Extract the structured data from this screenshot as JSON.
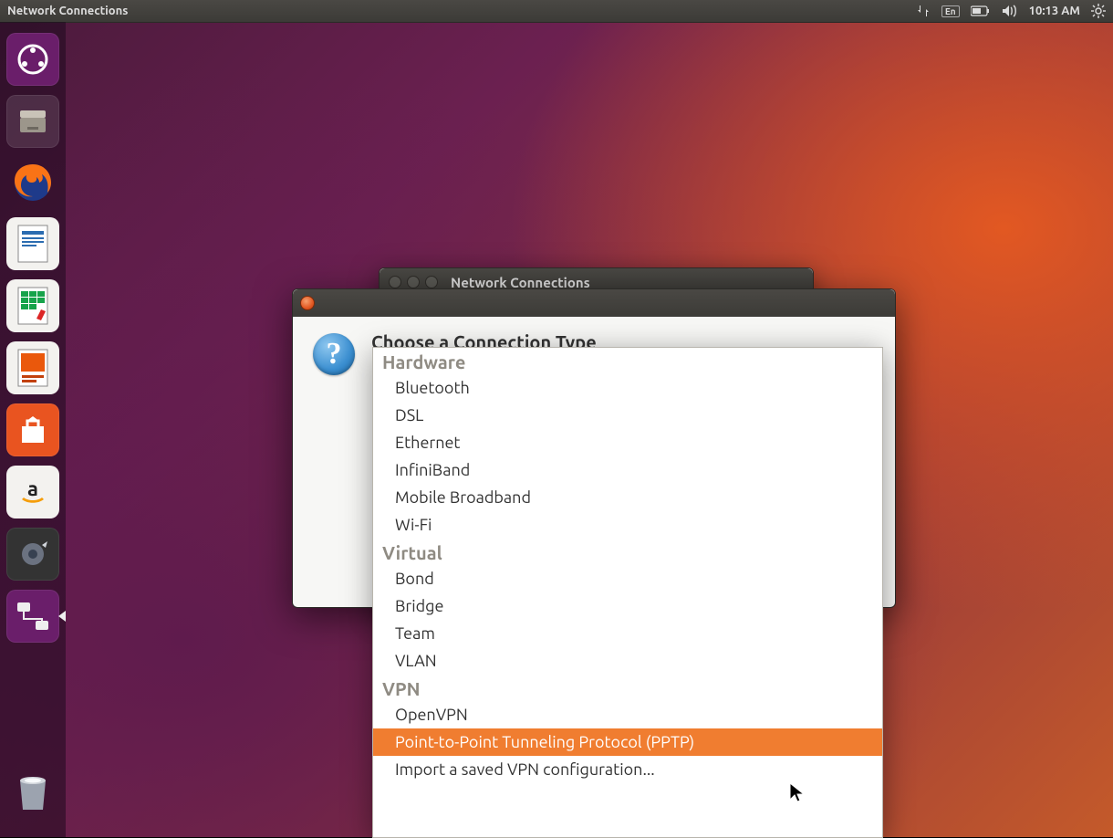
{
  "topbar": {
    "title": "Network Connections",
    "lang": "En",
    "time": "10:13 AM"
  },
  "launcher": {
    "items": [
      {
        "name": "dash",
        "label": "Ubuntu Dash"
      },
      {
        "name": "files",
        "label": "Files"
      },
      {
        "name": "firefox",
        "label": "Firefox"
      },
      {
        "name": "writer",
        "label": "LibreOffice Writer"
      },
      {
        "name": "calc",
        "label": "LibreOffice Calc"
      },
      {
        "name": "impress",
        "label": "LibreOffice Impress"
      },
      {
        "name": "software",
        "label": "Ubuntu Software"
      },
      {
        "name": "amazon",
        "label": "Amazon"
      },
      {
        "name": "settings",
        "label": "System Settings"
      },
      {
        "name": "network",
        "label": "Network Connections"
      }
    ],
    "trash": "Trash"
  },
  "bgWindow": {
    "title": "Network Connections"
  },
  "dialog": {
    "heading": "Choose a Connection Type",
    "groups": [
      {
        "label": "Hardware",
        "items": [
          "Bluetooth",
          "DSL",
          "Ethernet",
          "InfiniBand",
          "Mobile Broadband",
          "Wi-Fi"
        ]
      },
      {
        "label": "Virtual",
        "items": [
          "Bond",
          "Bridge",
          "Team",
          "VLAN"
        ]
      },
      {
        "label": "VPN",
        "items": [
          "OpenVPN",
          "Point-to-Point Tunneling Protocol (PPTP)",
          "Import a saved VPN configuration..."
        ]
      }
    ],
    "selected": "Point-to-Point Tunneling Protocol (PPTP)"
  }
}
